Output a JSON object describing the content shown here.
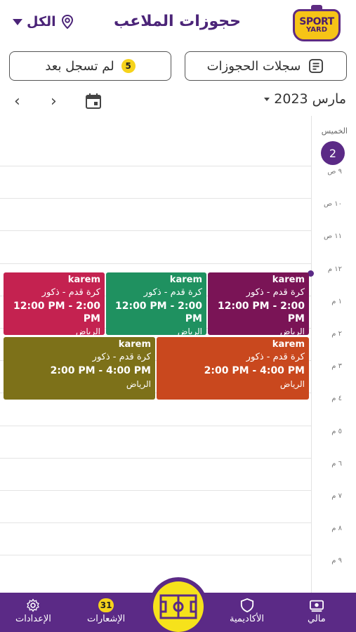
{
  "header": {
    "title": "حجوزات الملاعب",
    "location_filter": "الكل",
    "logo_line1": "SPORT",
    "logo_line2": "YARD"
  },
  "actions": {
    "records_label": "سجلات الحجوزات",
    "pending_label": "لم تسجل بعد",
    "pending_count": "5"
  },
  "calendar": {
    "month_label": "مارس 2023",
    "day_name": "الخميس",
    "day_number": "2",
    "hours": [
      "٩ ص",
      "١٠ ص",
      "١١ ص",
      "١٢ م",
      "١ م",
      "٢ م",
      "٣ م",
      "٤ م",
      "٥ م",
      "٦ م",
      "٧ م",
      "٨ م",
      "٩ م"
    ],
    "events": [
      {
        "who": "karem",
        "sport": "كرة قدم - ذكور",
        "time": "12:00 PM - 2:00 PM",
        "city": "الرياض",
        "color": "#7a1456"
      },
      {
        "who": "karem",
        "sport": "كرة قدم - ذكور",
        "time": "12:00 PM - 2:00 PM",
        "city": "الرياض",
        "color": "#1f9160"
      },
      {
        "who": "karem",
        "sport": "كرة قدم - ذكور",
        "time": "12:00 PM - 2:00 PM",
        "city": "الرياض",
        "color": "#c42250"
      },
      {
        "who": "karem",
        "sport": "كرة قدم - ذكور",
        "time": "2:00 PM - 4:00 PM",
        "city": "الرياض",
        "color": "#c9481e"
      },
      {
        "who": "karem",
        "sport": "كرة قدم - ذكور",
        "time": "2:00 PM - 4:00 PM",
        "city": "الرياض",
        "color": "#7d7119"
      }
    ]
  },
  "bottom_nav": {
    "finance": "مالي",
    "academies": "الأكاديمية",
    "notifications": "الإشعارات",
    "notifications_count": "31",
    "settings": "الإعدادات"
  },
  "colors": {
    "brand": "#5b2a86",
    "accent": "#f6d31b"
  }
}
